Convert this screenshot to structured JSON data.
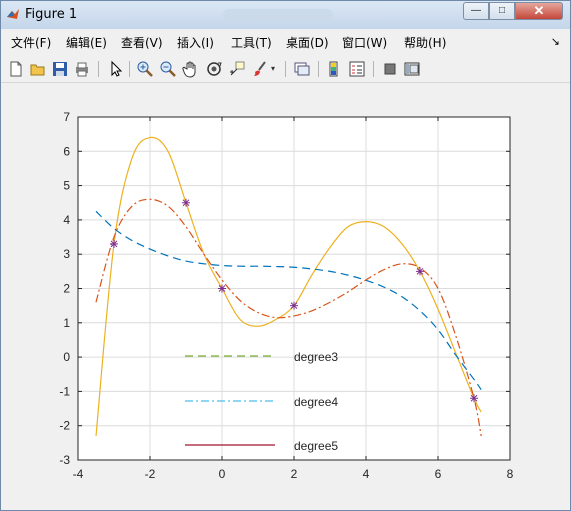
{
  "window": {
    "title": "Figure 1",
    "controls": {
      "minimize": "—",
      "maximize": "□",
      "close": "✕"
    }
  },
  "menu": [
    {
      "label": "文件(F)"
    },
    {
      "label": "编辑(E)"
    },
    {
      "label": "查看(V)"
    },
    {
      "label": "插入(I)"
    },
    {
      "label": "工具(T)"
    },
    {
      "label": "桌面(D)"
    },
    {
      "label": "窗口(W)"
    },
    {
      "label": "帮助(H)"
    }
  ],
  "menu_overflow_icon": "double-arrow-icon",
  "toolbar": [
    {
      "name": "new-figure-icon"
    },
    {
      "name": "open-file-icon"
    },
    {
      "name": "save-icon"
    },
    {
      "name": "print-icon"
    },
    {
      "name": "edit-plot-arrow-icon"
    },
    {
      "name": "zoom-in-icon"
    },
    {
      "name": "zoom-out-icon"
    },
    {
      "name": "pan-hand-icon"
    },
    {
      "name": "rotate-3d-icon"
    },
    {
      "name": "data-cursor-icon"
    },
    {
      "name": "brush-icon"
    },
    {
      "name": "link-plot-icon"
    },
    {
      "name": "colorbar-icon"
    },
    {
      "name": "legend-icon"
    },
    {
      "name": "hide-plot-tools-icon"
    },
    {
      "name": "show-plot-tools-icon"
    }
  ],
  "colors": {
    "degree3": "#77AC30",
    "degree4": "#4DBEEE",
    "degree5": "#A2142F",
    "curve_orange": "#EDB120",
    "curve_blue_dashed": "#0072BD",
    "curve_red_dashdot": "#D95319",
    "markers": "#7E2F8E"
  },
  "chart_data": {
    "type": "line",
    "xlim": [
      -4,
      8
    ],
    "ylim": [
      -3,
      7
    ],
    "x_ticks": [
      -4,
      -2,
      0,
      2,
      4,
      6,
      8
    ],
    "y_ticks": [
      -3,
      -2,
      -1,
      0,
      1,
      2,
      3,
      4,
      5,
      6,
      7
    ],
    "x_tick_labels": [
      "-4",
      "-2",
      "0",
      "2",
      "4",
      "6",
      "8"
    ],
    "y_tick_labels": [
      "-3",
      "-2",
      "-1",
      "0",
      "1",
      "2",
      "3",
      "4",
      "5",
      "6",
      "7"
    ],
    "grid": true,
    "legend_position": "inside-lower-left",
    "data_points": {
      "marker": "asterisk",
      "x": [
        -3,
        -1,
        0,
        2,
        5.5,
        7
      ],
      "y": [
        3.3,
        4.5,
        2.0,
        1.5,
        2.5,
        -1.2
      ]
    },
    "series": [
      {
        "style": "solid",
        "color_key": "curve_orange",
        "x": [
          -3.5,
          -3.0,
          -2.5,
          -2.0,
          -1.5,
          -1.0,
          -0.5,
          0.0,
          0.5,
          1.0,
          1.5,
          2.0,
          2.5,
          3.0,
          3.5,
          4.0,
          4.5,
          5.0,
          5.5,
          6.0,
          6.5,
          7.0,
          7.2
        ],
        "y": [
          -2.3,
          3.3,
          5.8,
          6.4,
          6.0,
          4.5,
          3.0,
          2.0,
          1.1,
          0.9,
          1.1,
          1.5,
          2.4,
          3.2,
          3.8,
          3.95,
          3.8,
          3.3,
          2.5,
          1.4,
          0.1,
          -1.2,
          -1.6
        ]
      },
      {
        "style": "dashed",
        "color_key": "curve_blue_dashed",
        "x": [
          -3.5,
          -3.0,
          -2.5,
          -2.0,
          -1.5,
          -1.0,
          -0.5,
          0.0,
          0.5,
          1.0,
          1.5,
          2.0,
          2.5,
          3.0,
          3.5,
          4.0,
          4.5,
          5.0,
          5.5,
          6.0,
          6.5,
          7.0,
          7.2
        ],
        "y": [
          4.25,
          3.75,
          3.4,
          3.15,
          2.95,
          2.8,
          2.72,
          2.67,
          2.65,
          2.65,
          2.64,
          2.62,
          2.57,
          2.5,
          2.39,
          2.24,
          2.04,
          1.76,
          1.35,
          0.8,
          0.05,
          -0.65,
          -0.95
        ]
      },
      {
        "style": "dash-dot",
        "color_key": "curve_red_dashdot",
        "x": [
          -3.5,
          -3.0,
          -2.5,
          -2.0,
          -1.5,
          -1.0,
          -0.5,
          0.0,
          0.5,
          1.0,
          1.5,
          2.0,
          2.5,
          3.0,
          3.5,
          4.0,
          4.5,
          5.0,
          5.5,
          6.0,
          6.5,
          7.0,
          7.2
        ],
        "y": [
          1.6,
          3.5,
          4.4,
          4.6,
          4.4,
          3.8,
          3.0,
          2.25,
          1.65,
          1.3,
          1.15,
          1.2,
          1.35,
          1.6,
          1.9,
          2.25,
          2.55,
          2.72,
          2.6,
          2.0,
          0.6,
          -1.2,
          -2.3
        ]
      }
    ],
    "legend": [
      {
        "label": "degree3",
        "style": "dashed",
        "color_key": "degree3"
      },
      {
        "label": "degree4",
        "style": "dash-dot",
        "color_key": "degree4"
      },
      {
        "label": "degree5",
        "style": "solid",
        "color_key": "degree5"
      }
    ]
  }
}
